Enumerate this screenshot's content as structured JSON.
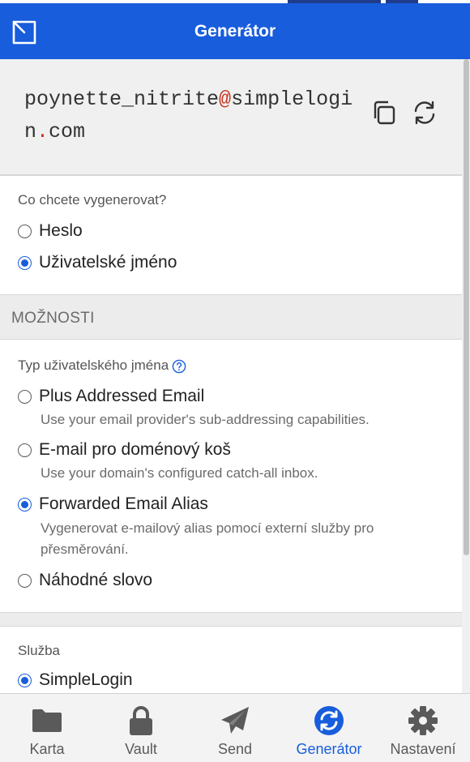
{
  "header": {
    "title": "Generátor"
  },
  "generated": {
    "part1": "poynette_nitrite",
    "at": "@",
    "part2": "simplelogin",
    "dot": ".",
    "part3": "com"
  },
  "what": {
    "label": "Co chcete vygenerovat?",
    "options": [
      {
        "label": "Heslo",
        "selected": false
      },
      {
        "label": "Uživatelské jméno",
        "selected": true
      }
    ]
  },
  "options_heading": "MOŽNOSTI",
  "username_type": {
    "label": "Typ uživatelského jména",
    "options": [
      {
        "label": "Plus Addressed Email",
        "desc": "Use your email provider's sub-addressing capabilities.",
        "selected": false
      },
      {
        "label": "E-mail pro doménový koš",
        "desc": "Use your domain's configured catch-all inbox.",
        "selected": false
      },
      {
        "label": "Forwarded Email Alias",
        "desc": "Vygenerovat e-mailový alias pomocí externí služby pro přesměrování.",
        "selected": true
      },
      {
        "label": "Náhodné slovo",
        "desc": "",
        "selected": false
      }
    ]
  },
  "service": {
    "label": "Služba",
    "options": [
      {
        "label": "SimpleLogin",
        "selected": true
      }
    ]
  },
  "nav": [
    {
      "label": "Karta",
      "icon": "folder-icon",
      "active": false
    },
    {
      "label": "Vault",
      "icon": "lock-icon",
      "active": false
    },
    {
      "label": "Send",
      "icon": "paper-plane-icon",
      "active": false
    },
    {
      "label": "Generátor",
      "icon": "generate-icon",
      "active": true
    },
    {
      "label": "Nastavení",
      "icon": "gear-icon",
      "active": false
    }
  ],
  "colors": {
    "brand": "#175ddc",
    "symbol": "#c83522"
  }
}
